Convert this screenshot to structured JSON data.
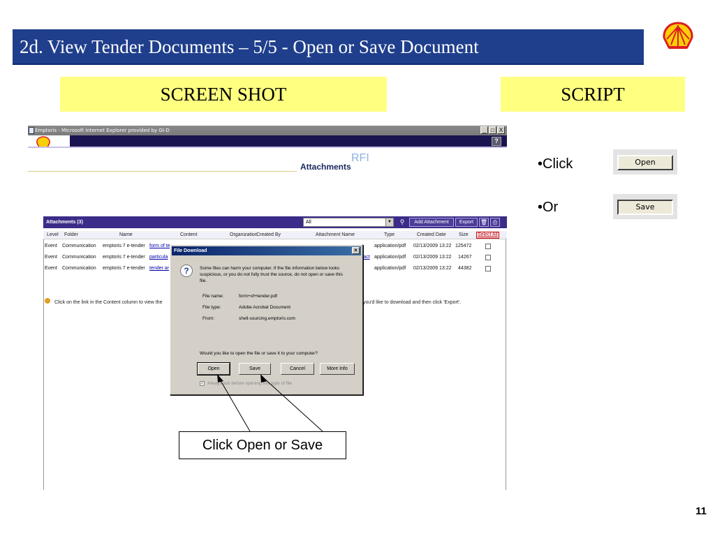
{
  "slide": {
    "title": "2d.  View Tender Documents – 5/5  - Open or Save  Document",
    "label_screenshot": "SCREEN SHOT",
    "label_script": "SCRIPT",
    "page_number": "11",
    "script": [
      {
        "prefix": "•Click",
        "button": "Open"
      },
      {
        "prefix": "•Or",
        "button": "Save"
      }
    ],
    "callout": "Click Open or Save",
    "colors": {
      "title_bg": "#1f3f8c",
      "label_bg": "#ffff80",
      "shell_red": "#dd1d21",
      "shell_yellow": "#fbce07"
    }
  },
  "browser": {
    "title": "Emptoris - Microsoft Internet Explorer provided by GI-D",
    "controls": [
      "_",
      "□",
      "X"
    ],
    "help_label": "?"
  },
  "page": {
    "rfi": "RFI",
    "heading": "Attachments"
  },
  "grid": {
    "title": "Attachments (3)",
    "filter_value": "All",
    "add_label": "Add Attachment",
    "export_label": "Export",
    "select_all": "Select All",
    "columns": [
      "Level",
      "Folder",
      "Name",
      "Content",
      "Organization",
      "Created By",
      "Attachment Name",
      "Type",
      "Created Date",
      "Size"
    ],
    "rows": [
      {
        "level": "Event",
        "folder": "Communication",
        "name": "emptoris 7 e-tender",
        "content": "form of te",
        "attach": "",
        "type": "application/pdf",
        "date": "02/13/2009 13:22",
        "size": "125472"
      },
      {
        "level": "Event",
        "folder": "Communication",
        "name": "emptoris 7 e-tender",
        "content": "particula",
        "attach": "ract",
        "type": "application/pdf",
        "date": "02/13/2009 13:22",
        "size": "14267"
      },
      {
        "level": "Event",
        "folder": "Communication",
        "name": "emptoris 7 e-tender",
        "content": "tender ar",
        "attach": "",
        "type": "application/pdf",
        "date": "02/13/2009 13:22",
        "size": "44382"
      }
    ],
    "hint_left": "Click on the link in the Content column to view the",
    "hint_right": "e you'd like to download and then click 'Export'."
  },
  "dialog": {
    "title": "File Download",
    "message": "Some files can harm your computer. If the file information below looks suspicious, or you do not fully trust the source, do not open or save this file.",
    "file_name_label": "File name:",
    "file_name": "form+of+tender.pdf",
    "file_type_label": "File type:",
    "file_type": "Adobe Acrobat Document",
    "from_label": "From:",
    "from": "shell-sourcing.emptoris.com",
    "question": "Would you like to open the file or save it to your computer?",
    "buttons": {
      "open": "Open",
      "save": "Save",
      "cancel": "Cancel",
      "more_info": "More Info"
    },
    "checkbox_label": "Always ask before opening this type of file",
    "checkbox_checked": true
  }
}
